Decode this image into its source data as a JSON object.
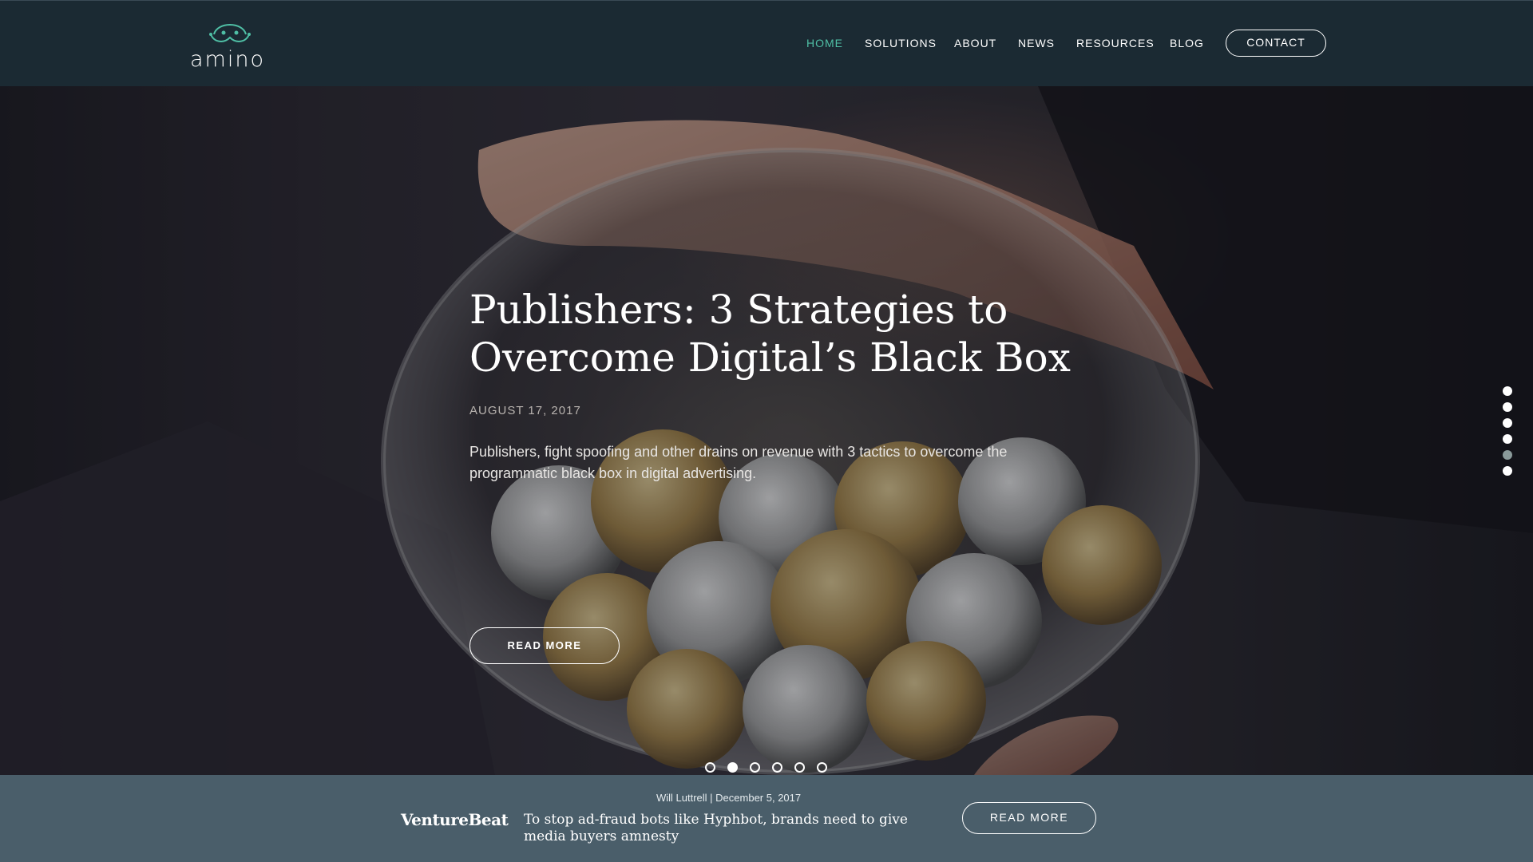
{
  "brand": {
    "logo_text": "amino",
    "logo_icon": "amino-logo-icon"
  },
  "nav": {
    "items": [
      {
        "label": "HOME",
        "active": true
      },
      {
        "label": "SOLUTIONS",
        "active": false
      },
      {
        "label": "ABOUT",
        "active": false
      },
      {
        "label": "NEWS",
        "active": false
      },
      {
        "label": "RESOURCES",
        "active": false
      },
      {
        "label": "BLOG",
        "active": false
      }
    ],
    "contact_label": "CONTACT"
  },
  "hero": {
    "title_line1": "Publishers: 3 Strategies to",
    "title_line2": "Overcome Digital’s Black Box",
    "date": "AUGUST 17, 2017",
    "description": "Publishers, fight spoofing and other drains on revenue with 3 tactics to overcome the programmatic black box in digital advertising.",
    "button_label": "READ MORE",
    "image_subject": "hands covering glass piggy bank full of euro coins"
  },
  "carousel": {
    "slide_count": 6,
    "active_slide": 2,
    "side_dots_count": 6,
    "side_active": 5
  },
  "footer": {
    "meta": "Will Luttrell | December 5, 2017",
    "source": "VentureBeat",
    "headline_line1": "To stop ad-fraud bots like Hyphbot, brands need to give",
    "headline_line2": "media buyers amnesty",
    "button_label": "READ MORE"
  },
  "colors": {
    "header_bg": "#1b2a33",
    "accent": "#4fbfa5",
    "footer_bg": "#4a5e6a"
  }
}
